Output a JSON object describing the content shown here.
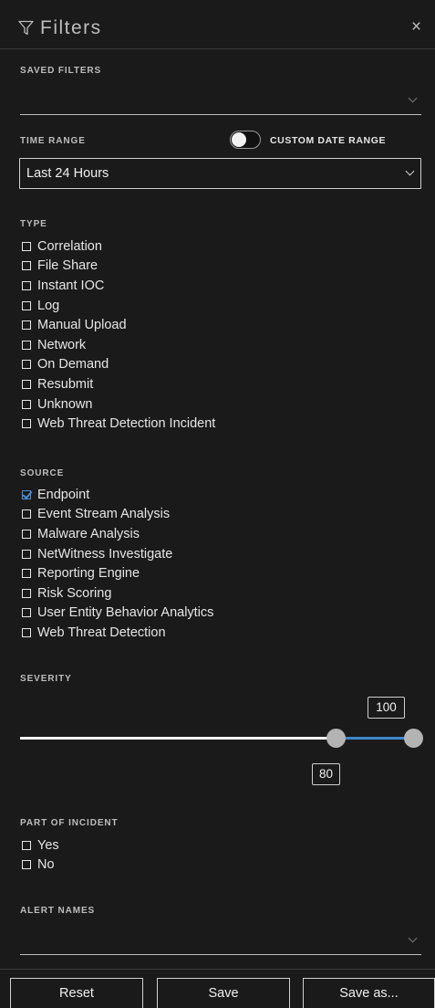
{
  "header": {
    "title": "Filters",
    "close_label": "×"
  },
  "saved_filters": {
    "label": "SAVED FILTERS",
    "value": ""
  },
  "time_range": {
    "label": "TIME RANGE",
    "custom_toggle_label": "CUSTOM DATE RANGE",
    "custom_enabled": false,
    "selected": "Last 24 Hours"
  },
  "type": {
    "label": "TYPE",
    "options": [
      {
        "label": "Correlation",
        "checked": false
      },
      {
        "label": "File Share",
        "checked": false
      },
      {
        "label": "Instant IOC",
        "checked": false
      },
      {
        "label": "Log",
        "checked": false
      },
      {
        "label": "Manual Upload",
        "checked": false
      },
      {
        "label": "Network",
        "checked": false
      },
      {
        "label": "On Demand",
        "checked": false
      },
      {
        "label": "Resubmit",
        "checked": false
      },
      {
        "label": "Unknown",
        "checked": false
      },
      {
        "label": "Web Threat Detection Incident",
        "checked": false
      }
    ]
  },
  "source": {
    "label": "SOURCE",
    "options": [
      {
        "label": "Endpoint",
        "checked": true
      },
      {
        "label": "Event Stream Analysis",
        "checked": false
      },
      {
        "label": "Malware Analysis",
        "checked": false
      },
      {
        "label": "NetWitness Investigate",
        "checked": false
      },
      {
        "label": "Reporting Engine",
        "checked": false
      },
      {
        "label": "Risk Scoring",
        "checked": false
      },
      {
        "label": "User Entity Behavior Analytics",
        "checked": false
      },
      {
        "label": "Web Threat Detection",
        "checked": false
      }
    ]
  },
  "severity": {
    "label": "SEVERITY",
    "min_value": "80",
    "max_value": "100",
    "range_color": "#3f86c9"
  },
  "part_of_incident": {
    "label": "PART OF INCIDENT",
    "options": [
      {
        "label": "Yes",
        "checked": false
      },
      {
        "label": "No",
        "checked": false
      }
    ]
  },
  "alert_names": {
    "label": "ALERT NAMES",
    "value": ""
  },
  "footer": {
    "reset_label": "Reset",
    "save_label": "Save",
    "save_as_label": "Save as..."
  },
  "icons": {
    "header": "filter-icon",
    "close": "close-icon",
    "dropdown": "chevron-down-icon"
  }
}
